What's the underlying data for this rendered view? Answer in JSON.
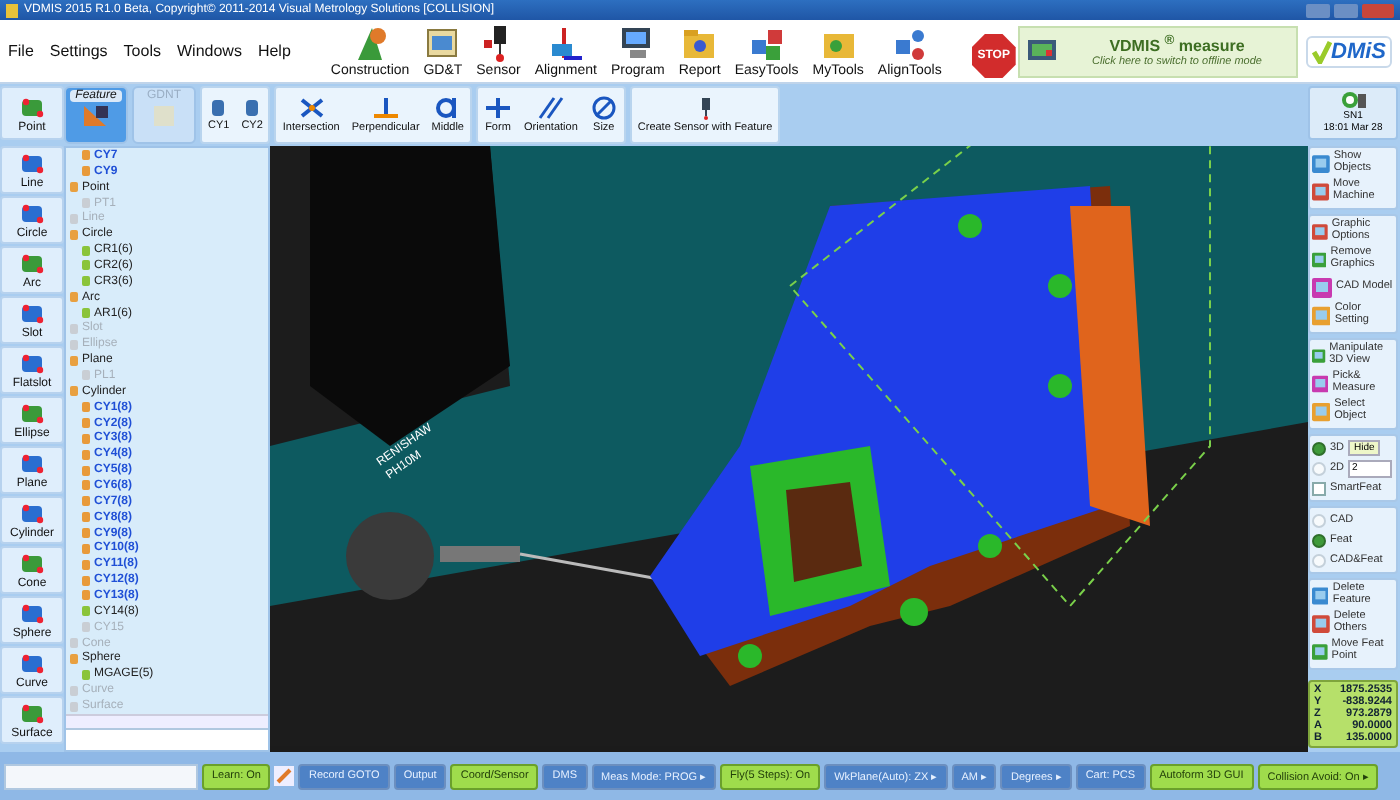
{
  "window": {
    "title": "VDMIS 2015 R1.0 Beta, Copyright© 2011-2014 Visual Metrology Solutions [COLLISION]"
  },
  "menu": [
    "File",
    "Settings",
    "Tools",
    "Windows",
    "Help"
  ],
  "toolbar": [
    "Construction",
    "GD&T",
    "Sensor",
    "Alignment",
    "Program",
    "Report",
    "EasyTools",
    "MyTools",
    "AlignTools"
  ],
  "stop_button": "STOP",
  "mode_panel": {
    "title": "VDMIS $^{®}$ measure",
    "hint": "Click here to switch to offline mode"
  },
  "logo": "DMiS",
  "left_tools": [
    "Point",
    "Line",
    "Circle",
    "Arc",
    "Slot",
    "Flatslot",
    "Ellipse",
    "Plane",
    "Cylinder",
    "Cone",
    "Sphere",
    "Curve",
    "Surface"
  ],
  "ribbon": {
    "tabs": [
      {
        "label": "Feature",
        "selected": true
      },
      {
        "label": "GDNT",
        "selected": false
      }
    ],
    "features": [
      "CY1",
      "CY2"
    ],
    "tools": [
      "Intersection",
      "Perpendicular",
      "Middle",
      "Form",
      "Orientation",
      "Size",
      "Create Sensor with Feature"
    ]
  },
  "machine": {
    "name": "SN1",
    "time": "18:01 Mar 28"
  },
  "tree": [
    {
      "label": "CY7",
      "kind": "feature",
      "disabled": false,
      "measured": true
    },
    {
      "label": "CY9",
      "kind": "feature",
      "disabled": false,
      "measured": true
    },
    {
      "label": "Point",
      "kind": "group",
      "disabled": false,
      "children": [
        {
          "label": "PT1",
          "disabled": true,
          "measured": false
        }
      ]
    },
    {
      "label": "Line",
      "kind": "group",
      "disabled": true
    },
    {
      "label": "Circle",
      "kind": "group",
      "disabled": false,
      "children": [
        {
          "label": "CR1(6)",
          "disabled": false,
          "measured": false
        },
        {
          "label": "CR2(6)",
          "disabled": false,
          "measured": false
        },
        {
          "label": "CR3(6)",
          "disabled": false,
          "measured": false
        }
      ]
    },
    {
      "label": "Arc",
      "kind": "group",
      "disabled": false,
      "children": [
        {
          "label": "AR1(6)",
          "disabled": false,
          "measured": false
        }
      ]
    },
    {
      "label": "Slot",
      "kind": "group",
      "disabled": true
    },
    {
      "label": "Ellipse",
      "kind": "group",
      "disabled": true
    },
    {
      "label": "Plane",
      "kind": "group",
      "disabled": false,
      "children": [
        {
          "label": "PL1",
          "disabled": true,
          "measured": false
        }
      ]
    },
    {
      "label": "Cylinder",
      "kind": "group",
      "disabled": false,
      "children": [
        {
          "label": "CY1(8)",
          "disabled": false,
          "measured": true
        },
        {
          "label": "CY2(8)",
          "disabled": false,
          "measured": true
        },
        {
          "label": "CY3(8)",
          "disabled": false,
          "measured": true
        },
        {
          "label": "CY4(8)",
          "disabled": false,
          "measured": true
        },
        {
          "label": "CY5(8)",
          "disabled": false,
          "measured": true
        },
        {
          "label": "CY6(8)",
          "disabled": false,
          "measured": true
        },
        {
          "label": "CY7(8)",
          "disabled": false,
          "measured": true
        },
        {
          "label": "CY8(8)",
          "disabled": false,
          "measured": true
        },
        {
          "label": "CY9(8)",
          "disabled": false,
          "measured": true
        },
        {
          "label": "CY10(8)",
          "disabled": false,
          "measured": true
        },
        {
          "label": "CY11(8)",
          "disabled": false,
          "measured": true
        },
        {
          "label": "CY12(8)",
          "disabled": false,
          "measured": true
        },
        {
          "label": "CY13(8)",
          "disabled": false,
          "measured": true
        },
        {
          "label": "CY14(8)",
          "disabled": false,
          "measured": false
        },
        {
          "label": "CY15",
          "disabled": true,
          "measured": false
        }
      ]
    },
    {
      "label": "Cone",
      "kind": "group",
      "disabled": true
    },
    {
      "label": "Sphere",
      "kind": "group",
      "disabled": false,
      "children": [
        {
          "label": "MGAGE(5)",
          "disabled": false,
          "measured": false
        }
      ]
    },
    {
      "label": "Curve",
      "kind": "group",
      "disabled": true
    },
    {
      "label": "Surface",
      "kind": "group",
      "disabled": true
    }
  ],
  "probe_label": [
    "RENISHAW",
    "PH10M"
  ],
  "side_panel": [
    {
      "kind": "buttons",
      "items": [
        "Show Objects",
        "Move Machine"
      ]
    },
    {
      "kind": "buttons",
      "items": [
        "Graphic Options",
        "Remove Graphics",
        "CAD Model",
        "Color Setting"
      ]
    },
    {
      "kind": "buttons",
      "items": [
        "Manipulate 3D View",
        "Pick& Measure",
        "Select Object"
      ]
    },
    {
      "kind": "view",
      "radios": [
        {
          "label": "3D",
          "selected": true
        },
        {
          "label": "2D",
          "selected": false
        }
      ],
      "hide_button": "Hide",
      "depth": "2",
      "smart": {
        "label": "SmartFeat",
        "checked": false
      }
    },
    {
      "kind": "radios",
      "items": [
        {
          "label": "CAD",
          "selected": false
        },
        {
          "label": "Feat",
          "selected": true
        },
        {
          "label": "CAD&Feat",
          "selected": false
        }
      ]
    },
    {
      "kind": "buttons",
      "items": [
        "Delete Feature",
        "Delete Others",
        "Move Feat Point"
      ]
    }
  ],
  "coordinates": [
    {
      "axis": "X",
      "value": "1875.2535"
    },
    {
      "axis": "Y",
      "value": "-838.9244"
    },
    {
      "axis": "Z",
      "value": "973.2879"
    },
    {
      "axis": "A",
      "value": "90.0000"
    },
    {
      "axis": "B",
      "value": "135.0000"
    }
  ],
  "status_bar": [
    {
      "label": "Learn: On",
      "on": true
    },
    {
      "label": "Record GOTO",
      "on": false
    },
    {
      "label": "Output",
      "on": false
    },
    {
      "label": "Coord/Sensor",
      "on": true
    },
    {
      "label": "DMS",
      "on": false
    },
    {
      "label": "Meas Mode: PROG ▸",
      "on": false
    },
    {
      "label": "Fly(5 Steps): On",
      "on": true
    },
    {
      "label": "WkPlane(Auto): ZX ▸",
      "on": false
    },
    {
      "label": "AM ▸",
      "on": false
    },
    {
      "label": "Degrees ▸",
      "on": false
    },
    {
      "label": "Cart: PCS",
      "on": false
    },
    {
      "label": "Autoform 3D GUI",
      "on": true
    },
    {
      "label": "Collision Avoid: On ▸",
      "on": true
    }
  ]
}
